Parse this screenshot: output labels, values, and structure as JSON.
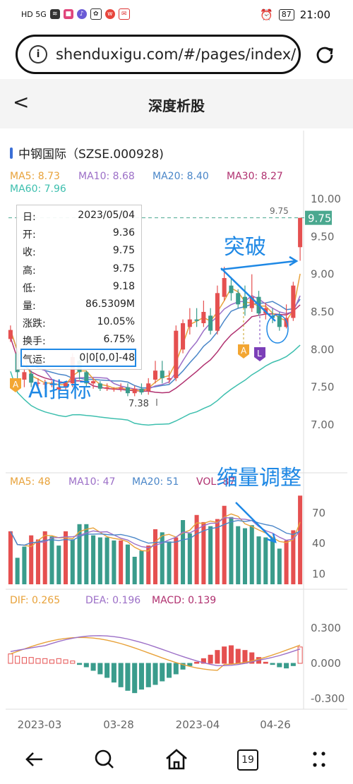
{
  "status_bar": {
    "left_label": "HD 5G",
    "battery": "87",
    "time": "21:00"
  },
  "browser": {
    "url": "shenduxigu.com/#/pages/index/"
  },
  "header": {
    "back_label": "<",
    "title": "深度析股"
  },
  "stock": {
    "name_code": "中钢国际（SZSE.000928)"
  },
  "ma": {
    "ma5": "MA5: 8.73",
    "ma10": "MA10: 8.68",
    "ma20": "MA20: 8.40",
    "ma30": "MA30: 8.27",
    "ma60": "MA60: 7.96",
    "colors": {
      "ma5": "#e8a23a",
      "ma10": "#9c6fc7",
      "ma20": "#4a86c8",
      "ma30": "#b0306f",
      "ma60": "#3dbfae"
    }
  },
  "price_axis": {
    "ticks": [
      "10.00",
      "9.50",
      "9.00",
      "8.50",
      "8.00",
      "7.50",
      "7.00"
    ],
    "current_price": "9.75",
    "high_mark": "9.75",
    "low_mark": "7.38"
  },
  "tooltip": {
    "rows": [
      {
        "label": "日:",
        "value": "2023/05/04"
      },
      {
        "label": "开:",
        "value": "9.36"
      },
      {
        "label": "收:",
        "value": "9.75"
      },
      {
        "label": "高:",
        "value": "9.75"
      },
      {
        "label": "低:",
        "value": "9.18"
      },
      {
        "label": "量:",
        "value": "86.5309M"
      },
      {
        "label": "涨跌:",
        "value": "10.05%"
      },
      {
        "label": "换手:",
        "value": "6.75%"
      },
      {
        "label": "气运:",
        "value": "0|0[0,0]-48"
      }
    ]
  },
  "annotations": {
    "breakout": "突破",
    "ai_indicator": "AI指标",
    "volume_shrink": "缩量调整"
  },
  "markers": {
    "a": "A",
    "l": "L"
  },
  "volume": {
    "legend": {
      "ma5": "MA5: 48",
      "ma10": "MA10: 47",
      "ma20": "MA20: 51",
      "vol": "VOL: 87"
    },
    "ticks": [
      "70",
      "40",
      "10"
    ]
  },
  "macd": {
    "legend": {
      "dif": "DIF: 0.265",
      "dea": "DEA: 0.196",
      "macd": "MACD: 0.139"
    },
    "ticks": [
      "0.300",
      "0.000",
      "-0.300"
    ]
  },
  "date_axis": [
    "2023-03",
    "03-28",
    "2023-04",
    "04-26"
  ],
  "bottom_nav": {
    "tabs_count": "19"
  },
  "chart_data": {
    "type": "candlestick",
    "candles": [
      {
        "o": 8.14,
        "c": 8.26,
        "h": 8.32,
        "l": 8.1
      },
      {
        "o": 7.95,
        "c": 7.7,
        "h": 8.0,
        "l": 7.6
      },
      {
        "o": 7.6,
        "c": 7.7,
        "h": 7.75,
        "l": 7.5
      },
      {
        "o": 7.68,
        "c": 7.56,
        "h": 7.72,
        "l": 7.5
      },
      {
        "o": 7.55,
        "c": 7.56,
        "h": 7.62,
        "l": 7.48
      },
      {
        "o": 7.55,
        "c": 7.55,
        "h": 7.6,
        "l": 7.48
      },
      {
        "o": 7.55,
        "c": 7.55,
        "h": 7.58,
        "l": 7.5
      },
      {
        "o": 7.47,
        "c": 7.5,
        "h": 7.55,
        "l": 7.4
      },
      {
        "o": 7.5,
        "c": 7.55,
        "h": 7.58,
        "l": 7.45
      },
      {
        "o": 7.55,
        "c": 7.9,
        "h": 7.95,
        "l": 7.5
      },
      {
        "o": 7.85,
        "c": 7.7,
        "h": 7.9,
        "l": 7.6
      },
      {
        "o": 7.7,
        "c": 7.55,
        "h": 7.72,
        "l": 7.5
      },
      {
        "o": 7.55,
        "c": 7.58,
        "h": 7.62,
        "l": 7.48
      },
      {
        "o": 7.55,
        "c": 7.48,
        "h": 7.58,
        "l": 7.45
      },
      {
        "o": 7.48,
        "c": 7.5,
        "h": 7.55,
        "l": 7.45
      },
      {
        "o": 7.48,
        "c": 7.48,
        "h": 7.5,
        "l": 7.44
      },
      {
        "o": 7.48,
        "c": 7.5,
        "h": 7.55,
        "l": 7.44
      },
      {
        "o": 7.5,
        "c": 7.42,
        "h": 7.55,
        "l": 7.38
      },
      {
        "o": 7.42,
        "c": 7.48,
        "h": 7.52,
        "l": 7.38
      },
      {
        "o": 7.48,
        "c": 7.43,
        "h": 7.55,
        "l": 7.4
      },
      {
        "o": 7.45,
        "c": 7.55,
        "h": 7.62,
        "l": 7.4
      },
      {
        "o": 7.6,
        "c": 7.72,
        "h": 7.85,
        "l": 7.55
      },
      {
        "o": 7.72,
        "c": 7.62,
        "h": 7.85,
        "l": 7.55
      },
      {
        "o": 7.6,
        "c": 7.62,
        "h": 7.72,
        "l": 7.55
      },
      {
        "o": 7.62,
        "c": 8.25,
        "h": 8.32,
        "l": 7.58
      },
      {
        "o": 8.0,
        "c": 8.35,
        "h": 8.4,
        "l": 7.95
      },
      {
        "o": 8.3,
        "c": 8.4,
        "h": 8.55,
        "l": 8.2
      },
      {
        "o": 8.4,
        "c": 8.38,
        "h": 8.55,
        "l": 8.3
      },
      {
        "o": 8.35,
        "c": 8.5,
        "h": 8.65,
        "l": 8.3
      },
      {
        "o": 8.45,
        "c": 8.25,
        "h": 8.55,
        "l": 8.2
      },
      {
        "o": 8.25,
        "c": 8.75,
        "h": 8.85,
        "l": 8.2
      },
      {
        "o": 8.7,
        "c": 8.95,
        "h": 9.1,
        "l": 8.65
      },
      {
        "o": 8.85,
        "c": 8.75,
        "h": 8.95,
        "l": 8.65
      },
      {
        "o": 8.75,
        "c": 8.6,
        "h": 8.8,
        "l": 8.55
      },
      {
        "o": 8.7,
        "c": 8.55,
        "h": 8.85,
        "l": 8.45
      },
      {
        "o": 8.55,
        "c": 8.7,
        "h": 9.0,
        "l": 8.5
      },
      {
        "o": 8.7,
        "c": 8.48,
        "h": 8.78,
        "l": 8.45
      },
      {
        "o": 8.48,
        "c": 8.55,
        "h": 8.62,
        "l": 8.4
      },
      {
        "o": 8.45,
        "c": 8.42,
        "h": 8.55,
        "l": 8.35
      },
      {
        "o": 8.45,
        "c": 8.3,
        "h": 8.5,
        "l": 8.25
      },
      {
        "o": 8.3,
        "c": 8.42,
        "h": 8.6,
        "l": 8.28
      },
      {
        "o": 8.42,
        "c": 8.85,
        "h": 8.9,
        "l": 8.38
      },
      {
        "o": 9.36,
        "c": 9.75,
        "h": 9.75,
        "l": 9.18
      }
    ],
    "volume": [
      52,
      26,
      37,
      48,
      44,
      52,
      47,
      38,
      52,
      44,
      59,
      59,
      48,
      46,
      46,
      43,
      43,
      39,
      27,
      33,
      38,
      54,
      51,
      42,
      46,
      63,
      50,
      68,
      61,
      57,
      64,
      77,
      66,
      57,
      55,
      58,
      47,
      46,
      45,
      35,
      43,
      53,
      87
    ],
    "volume_up": [
      1,
      0,
      0,
      1,
      1,
      1,
      0,
      0,
      1,
      0,
      0,
      0,
      0,
      0,
      0,
      0,
      1,
      0,
      0,
      0,
      1,
      1,
      0,
      0,
      1,
      0,
      0,
      1,
      1,
      0,
      1,
      1,
      0,
      0,
      0,
      0,
      0,
      0,
      0,
      0,
      1,
      1,
      1
    ],
    "macd_hist": [
      0.08,
      0.06,
      0.05,
      0.05,
      0.04,
      0.04,
      0.03,
      0.04,
      0.03,
      0.02,
      -0.01,
      -0.03,
      -0.06,
      -0.09,
      -0.12,
      -0.16,
      -0.2,
      -0.23,
      -0.25,
      -0.22,
      -0.2,
      -0.18,
      -0.15,
      -0.12,
      -0.09,
      -0.05,
      -0.02,
      0.01,
      0.04,
      0.07,
      0.11,
      0.14,
      0.15,
      0.12,
      0.11,
      0.09,
      0.05,
      0.01,
      -0.01,
      -0.03,
      -0.04,
      -0.02,
      0.139
    ]
  }
}
